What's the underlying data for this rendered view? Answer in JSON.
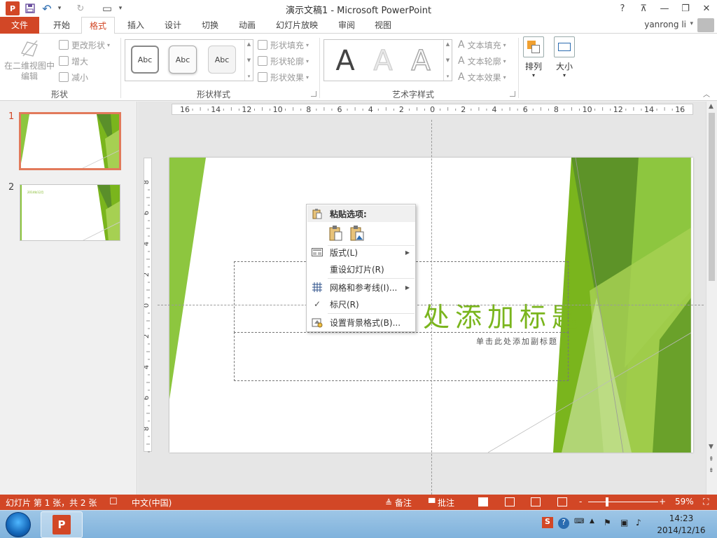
{
  "window": {
    "title": "演示文稿1 - Microsoft PowerPoint",
    "help": "?",
    "ribbon_display": "⊼",
    "minimize": "—",
    "restore": "❐",
    "close": "✕"
  },
  "qat": {
    "app_letter": "P",
    "save": "💾",
    "undo": "↶",
    "undo_dd": "▾",
    "redo": "↻",
    "present": "▭",
    "customize": "▾"
  },
  "tabs": [
    {
      "label": "文件",
      "kind": "file"
    },
    {
      "label": "开始"
    },
    {
      "label": "格式",
      "kind": "active"
    },
    {
      "label": "插入"
    },
    {
      "label": "设计"
    },
    {
      "label": "切换"
    },
    {
      "label": "动画"
    },
    {
      "label": "幻灯片放映"
    },
    {
      "label": "审阅"
    },
    {
      "label": "视图"
    }
  ],
  "user": {
    "name": "yanrong li",
    "caret": "▾"
  },
  "ribbon": {
    "shapes_group": {
      "label": "形状",
      "edit_3d": "在二维视图中编辑",
      "change_shape": "更改形状",
      "larger": "增大",
      "smaller": "减小"
    },
    "shape_styles_group": {
      "label": "形状样式",
      "swatches": [
        "Abc",
        "Abc",
        "Abc"
      ],
      "fill": "形状填充",
      "outline": "形状轮廓",
      "effects": "形状效果"
    },
    "wordart_group": {
      "label": "艺术字样式",
      "letters": [
        "A",
        "A",
        "A"
      ],
      "text_fill": "文本填充",
      "text_outline": "文本轮廓",
      "text_effects": "文本效果"
    },
    "arrange": "排列",
    "size": "大小"
  },
  "slides": [
    {
      "number": "1",
      "selected": true
    },
    {
      "number": "2",
      "date_text": "2014年12月"
    }
  ],
  "ruler": {
    "h_labels": [
      "16",
      "14",
      "12",
      "10",
      "8",
      "6",
      "4",
      "2",
      "0",
      "2",
      "4",
      "6",
      "8",
      "10",
      "12",
      "14",
      "16"
    ],
    "v_labels": [
      "8",
      "6",
      "4",
      "2",
      "0",
      "2",
      "4",
      "6",
      "8"
    ]
  },
  "slide_content": {
    "title": "处添加标题",
    "subtitle": "单击此处添加副标题"
  },
  "context_menu": {
    "paste_header": "粘贴选项:",
    "items": [
      {
        "label": "版式(L)",
        "submenu": true,
        "icon": "layout-icon"
      },
      {
        "label": "重设幻灯片(R)",
        "submenu": false
      },
      {
        "label": "网格和参考线(I)...",
        "submenu": true,
        "icon": "grid-icon"
      },
      {
        "label": "标尺(R)",
        "submenu": false,
        "checked": true
      },
      {
        "label": "设置背景格式(B)...",
        "submenu": false,
        "icon": "background-icon"
      }
    ],
    "check": "✓",
    "arrow": "▶"
  },
  "statusbar": {
    "slide_info": "幻灯片 第 1 张，共 2 张",
    "language": "中文(中国)",
    "notes": "备注",
    "comments": "批注",
    "zoom_minus": "-",
    "zoom_plus": "+",
    "zoom": "59%",
    "zoom_level": 0.59
  },
  "taskbar": {
    "app_letter": "P",
    "time": "14:23",
    "date": "2014/12/16",
    "ime": "S"
  },
  "colors": {
    "accent": "#d24726",
    "green_dark": "#5a8f2a",
    "green": "#7ab51d",
    "green_light": "#a6d052"
  }
}
